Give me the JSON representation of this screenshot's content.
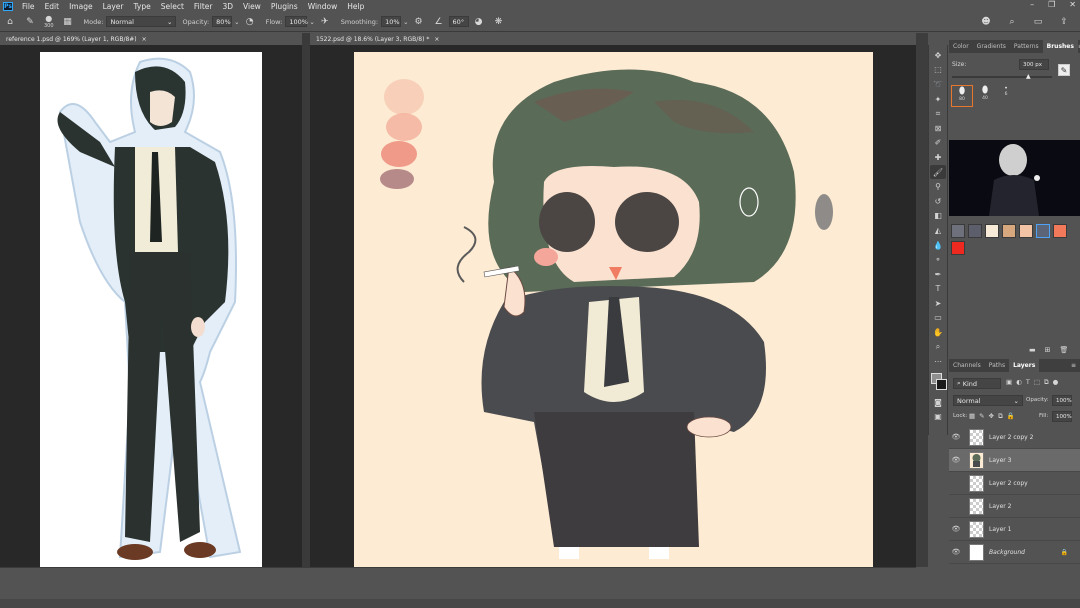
{
  "app": {
    "logo": "Ps",
    "menu": [
      "File",
      "Edit",
      "Image",
      "Layer",
      "Type",
      "Select",
      "Filter",
      "3D",
      "View",
      "Plugins",
      "Window",
      "Help"
    ]
  },
  "options": {
    "brush_size": "300",
    "mode_label": "Mode:",
    "mode_value": "Normal",
    "opacity_label": "Opacity:",
    "opacity_value": "80%",
    "flow_label": "Flow:",
    "flow_value": "100%",
    "smoothing_label": "Smoothing:",
    "smoothing_value": "10%",
    "angle_value": "60°"
  },
  "documents": {
    "left_tab": "reference 1.psd @ 169% (Layer 1, RGB/8#)",
    "right_tab": "1522.psd @ 18.6% (Layer 3, RGB/8) *"
  },
  "brushes_panel": {
    "tabs": [
      "Color",
      "Gradients",
      "Patterns",
      "Brushes"
    ],
    "active_tab": "Brushes",
    "size_label": "Size:",
    "size_value": "300 px",
    "presets": [
      "80",
      "40",
      "6"
    ]
  },
  "swatches": [
    "#6e707c",
    "#5c5f6b",
    "#f7ead7",
    "#d7a87e",
    "#f2c3a4",
    "#5c6577",
    "#f2795a",
    "#ee2a20"
  ],
  "layers_panel": {
    "tabs": [
      "Channels",
      "Paths",
      "Layers"
    ],
    "active_tab": "Layers",
    "filter_kind": "Kind",
    "blend_mode": "Normal",
    "opacity_label": "Opacity:",
    "opacity_value": "100%",
    "lock_label": "Lock:",
    "fill_label": "Fill:",
    "fill_value": "100%",
    "layers": [
      {
        "name": "Layer 2 copy 2",
        "visible": true,
        "selected": false
      },
      {
        "name": "Layer 3",
        "visible": true,
        "selected": true
      },
      {
        "name": "Layer 2 copy",
        "visible": false,
        "selected": false
      },
      {
        "name": "Layer 2",
        "visible": false,
        "selected": false
      },
      {
        "name": "Layer 1",
        "visible": true,
        "selected": false
      },
      {
        "name": "Background",
        "visible": true,
        "selected": false
      }
    ]
  },
  "colors": {
    "foreground": "#8f8f8f",
    "background": "#1a1a1a",
    "canvas_bg": "#fdebd3",
    "accent_selection": "#e8772e"
  }
}
